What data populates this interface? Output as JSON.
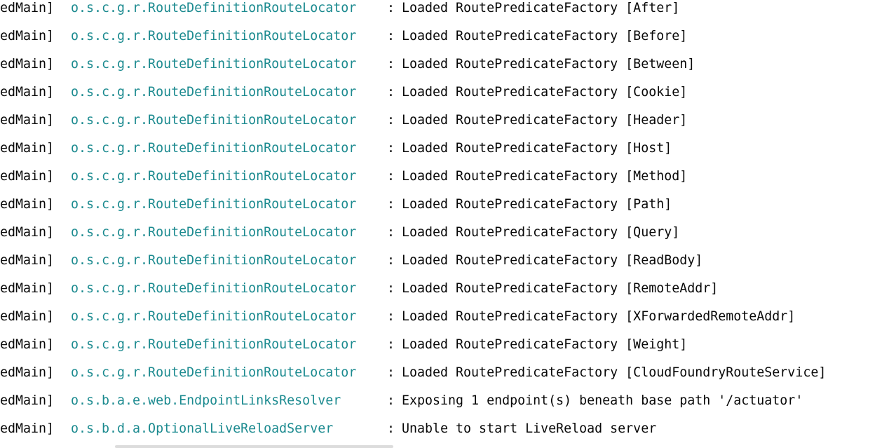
{
  "console": {
    "lines": [
      {
        "thread": "edMain]",
        "logger": "o.s.c.g.r.RouteDefinitionRouteLocator",
        "sep": ":",
        "message": "Loaded RoutePredicateFactory [After]"
      },
      {
        "thread": "edMain]",
        "logger": "o.s.c.g.r.RouteDefinitionRouteLocator",
        "sep": ":",
        "message": "Loaded RoutePredicateFactory [Before]"
      },
      {
        "thread": "edMain]",
        "logger": "o.s.c.g.r.RouteDefinitionRouteLocator",
        "sep": ":",
        "message": "Loaded RoutePredicateFactory [Between]"
      },
      {
        "thread": "edMain]",
        "logger": "o.s.c.g.r.RouteDefinitionRouteLocator",
        "sep": ":",
        "message": "Loaded RoutePredicateFactory [Cookie]"
      },
      {
        "thread": "edMain]",
        "logger": "o.s.c.g.r.RouteDefinitionRouteLocator",
        "sep": ":",
        "message": "Loaded RoutePredicateFactory [Header]"
      },
      {
        "thread": "edMain]",
        "logger": "o.s.c.g.r.RouteDefinitionRouteLocator",
        "sep": ":",
        "message": "Loaded RoutePredicateFactory [Host]"
      },
      {
        "thread": "edMain]",
        "logger": "o.s.c.g.r.RouteDefinitionRouteLocator",
        "sep": ":",
        "message": "Loaded RoutePredicateFactory [Method]"
      },
      {
        "thread": "edMain]",
        "logger": "o.s.c.g.r.RouteDefinitionRouteLocator",
        "sep": ":",
        "message": "Loaded RoutePredicateFactory [Path]"
      },
      {
        "thread": "edMain]",
        "logger": "o.s.c.g.r.RouteDefinitionRouteLocator",
        "sep": ":",
        "message": "Loaded RoutePredicateFactory [Query]"
      },
      {
        "thread": "edMain]",
        "logger": "o.s.c.g.r.RouteDefinitionRouteLocator",
        "sep": ":",
        "message": "Loaded RoutePredicateFactory [ReadBody]"
      },
      {
        "thread": "edMain]",
        "logger": "o.s.c.g.r.RouteDefinitionRouteLocator",
        "sep": ":",
        "message": "Loaded RoutePredicateFactory [RemoteAddr]"
      },
      {
        "thread": "edMain]",
        "logger": "o.s.c.g.r.RouteDefinitionRouteLocator",
        "sep": ":",
        "message": "Loaded RoutePredicateFactory [XForwardedRemoteAddr]"
      },
      {
        "thread": "edMain]",
        "logger": "o.s.c.g.r.RouteDefinitionRouteLocator",
        "sep": ":",
        "message": "Loaded RoutePredicateFactory [Weight]"
      },
      {
        "thread": "edMain]",
        "logger": "o.s.c.g.r.RouteDefinitionRouteLocator",
        "sep": ":",
        "message": "Loaded RoutePredicateFactory [CloudFoundryRouteService]"
      },
      {
        "thread": "edMain]",
        "logger": "o.s.b.a.e.web.EndpointLinksResolver",
        "sep": ":",
        "message": "Exposing 1 endpoint(s) beneath base path '/actuator'"
      },
      {
        "thread": "edMain]",
        "logger": "o.s.b.d.a.OptionalLiveReloadServer",
        "sep": ":",
        "message": "Unable to start LiveReload server"
      }
    ]
  },
  "colors": {
    "background": "#ffffff",
    "text": "#080808",
    "logger": "#1b8a8f",
    "scrollbar": "#dcdcdc"
  }
}
